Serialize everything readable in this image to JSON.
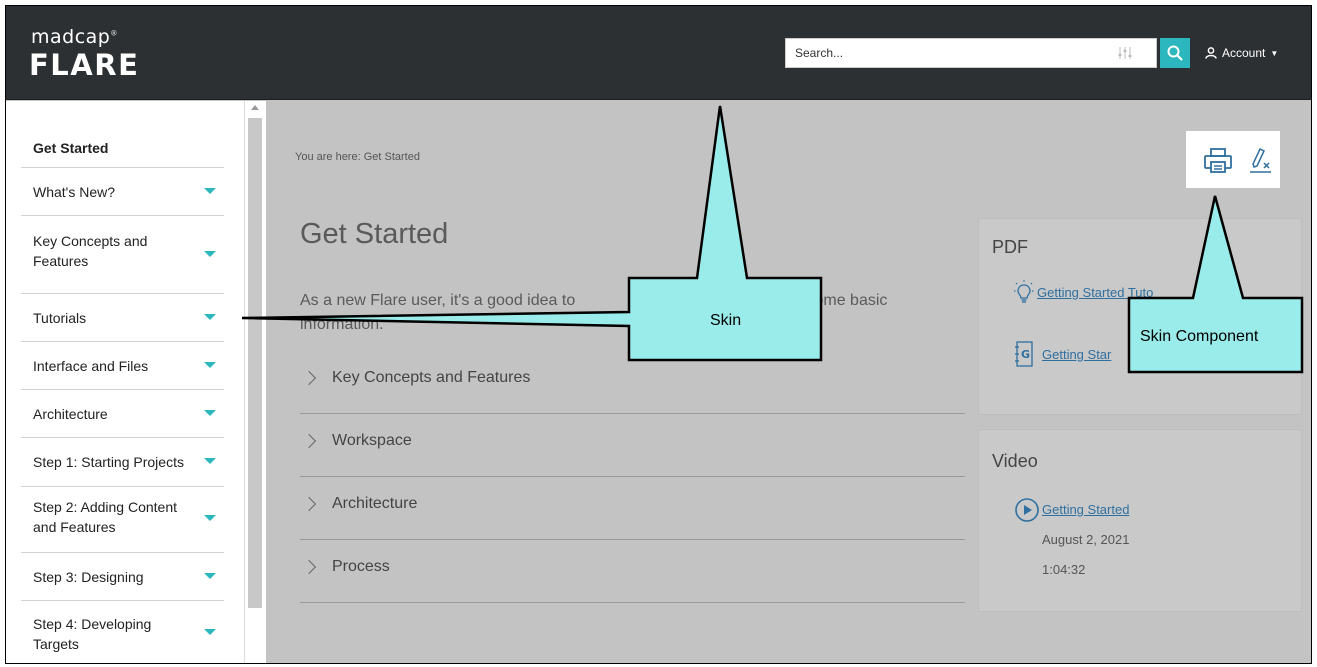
{
  "header": {
    "logo_top": "madcap",
    "logo_registered": "®",
    "logo_bottom": "FLARE",
    "search_placeholder": "Search...",
    "account_label": "Account",
    "accent_color": "#2bb7bd"
  },
  "sidebar": {
    "items": [
      {
        "label": "Get Started",
        "expandable": false
      },
      {
        "label": "What's New?",
        "expandable": true
      },
      {
        "label": "Key Concepts and Features",
        "expandable": true
      },
      {
        "label": "Tutorials",
        "expandable": true
      },
      {
        "label": "Interface and Files",
        "expandable": true
      },
      {
        "label": "Architecture",
        "expandable": true
      },
      {
        "label": "Step 1: Starting Projects",
        "expandable": true
      },
      {
        "label": "Step 2: Adding Content and Features",
        "expandable": true
      },
      {
        "label": "Step 3: Designing",
        "expandable": true
      },
      {
        "label": "Step 4: Developing Targets",
        "expandable": true
      }
    ]
  },
  "main": {
    "breadcrumb": "You are here: Get Started",
    "title": "Get Started",
    "intro_part1": "As a new Flare user, it's a good idea to",
    "intro_part2": "n some basic",
    "intro_line2": "information.",
    "sections": [
      {
        "label": "Key Concepts and Features"
      },
      {
        "label": "Workspace"
      },
      {
        "label": "Architecture"
      },
      {
        "label": "Process"
      }
    ]
  },
  "pdf_panel": {
    "title": "PDF",
    "link1": "Getting Started Tuto",
    "link2": "Getting Star"
  },
  "video_panel": {
    "title": "Video",
    "link": "Getting Started",
    "date": "August 2, 2021",
    "duration": "1:04:32"
  },
  "callouts": {
    "skin": "Skin",
    "skin_component": "Skin Component",
    "fill_color": "#9aeceb"
  }
}
